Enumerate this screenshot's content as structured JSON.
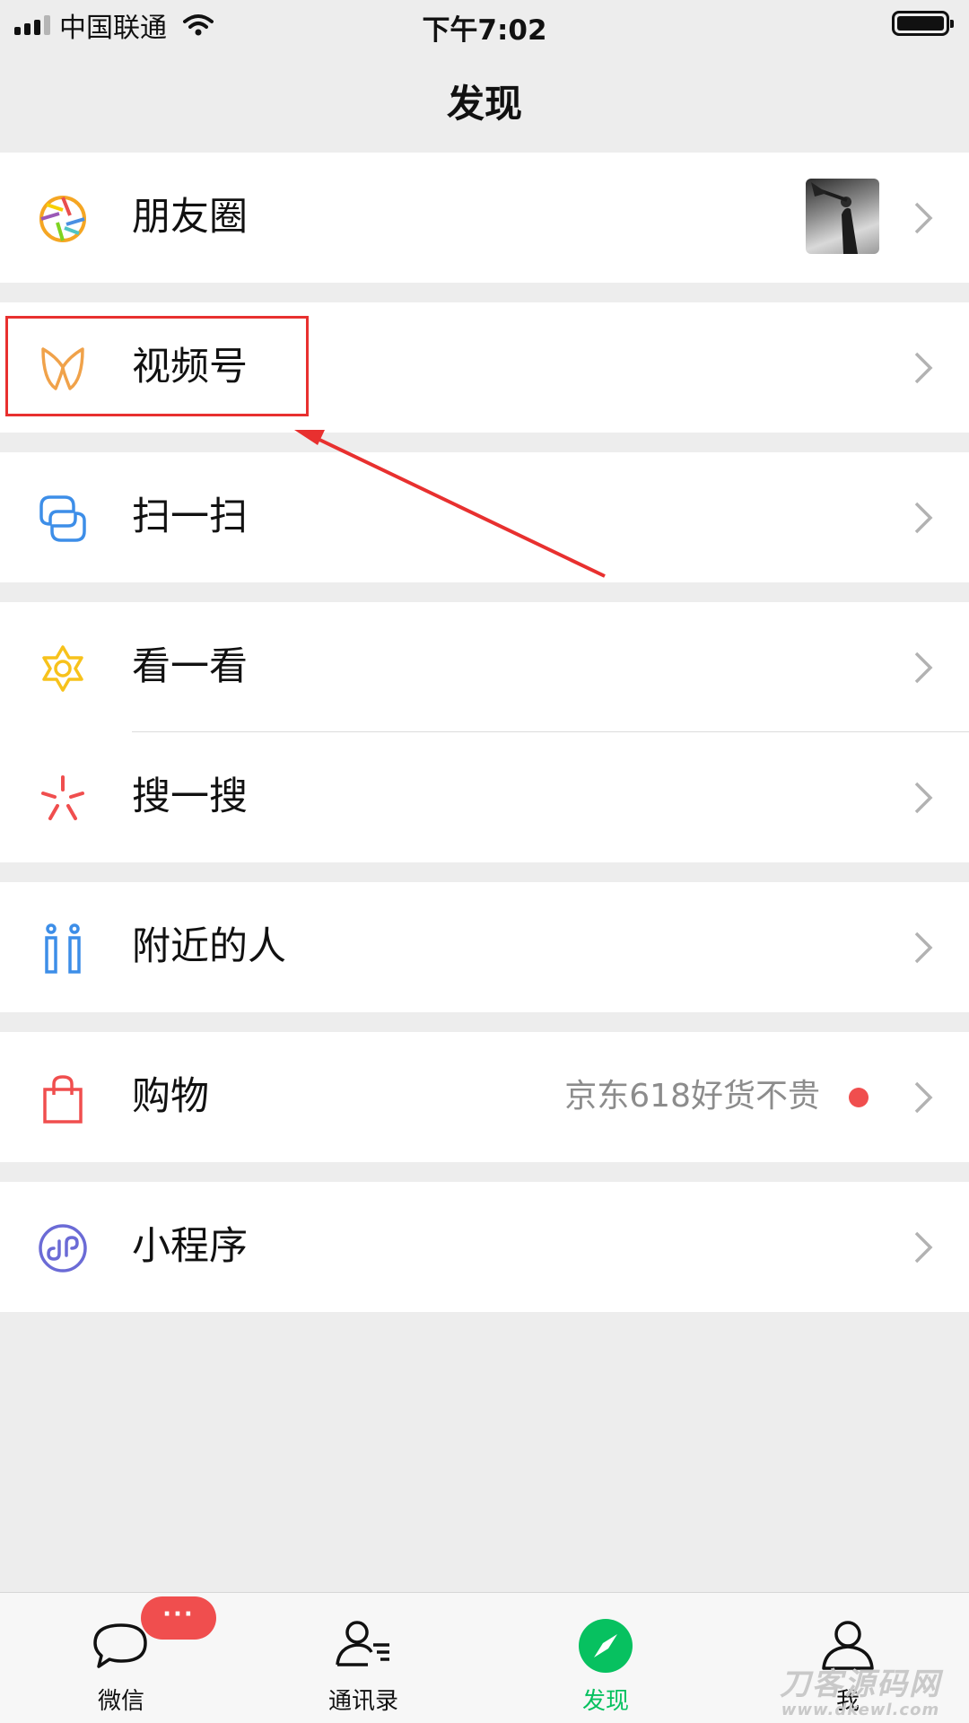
{
  "status_bar": {
    "carrier": "中国联通",
    "time": "下午7:02"
  },
  "nav": {
    "title": "发现"
  },
  "rows": [
    {
      "label": "朋友圈",
      "icon": "moments-icon",
      "has_thumbnail": true
    },
    {
      "label": "视频号",
      "icon": "channels-icon"
    },
    {
      "label": "扫一扫",
      "icon": "scan-icon"
    },
    {
      "label": "看一看",
      "icon": "top-stories-icon"
    },
    {
      "label": "搜一搜",
      "icon": "search-icon"
    },
    {
      "label": "附近的人",
      "icon": "people-nearby-icon"
    },
    {
      "label": "购物",
      "icon": "shopping-bag-icon",
      "subtext": "京东618好货不贵",
      "red_dot": true
    },
    {
      "label": "小程序",
      "icon": "mini-programs-icon"
    }
  ],
  "tab_bar": {
    "tabs": [
      {
        "label": "微信",
        "icon": "chat-bubble-icon",
        "badge": "···"
      },
      {
        "label": "通讯录",
        "icon": "contacts-icon"
      },
      {
        "label": "发现",
        "icon": "compass-icon",
        "active": true
      },
      {
        "label": "我",
        "icon": "person-icon"
      }
    ]
  },
  "watermark": {
    "title": "刀客源码网",
    "url": "www.dkewl.com"
  },
  "colors": {
    "accent_green": "#07c160",
    "annotation_red": "#e8302f",
    "badge_red": "#f04e4e",
    "background": "#ededed"
  }
}
